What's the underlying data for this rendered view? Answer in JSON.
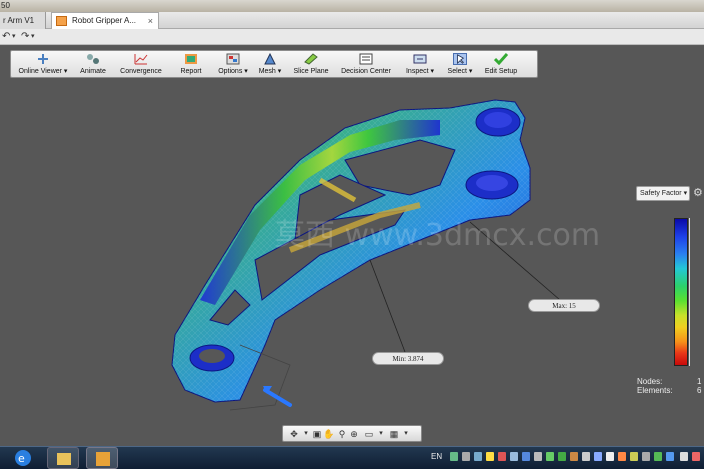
{
  "window": {
    "title_fragment": "50"
  },
  "tabs": [
    {
      "label": "r Arm V1"
    },
    {
      "label": "Robot Gripper A...",
      "close": "×"
    }
  ],
  "quick_access": {
    "undo": "↶",
    "redo": "↷"
  },
  "ribbon": [
    {
      "label": "Online Viewer ▾",
      "icon": "online-viewer-icon"
    },
    {
      "label": "Animate",
      "icon": "animate-icon"
    },
    {
      "label": "Convergence",
      "icon": "convergence-icon"
    },
    {
      "label": "Report",
      "icon": "report-icon"
    },
    {
      "label": "Options ▾",
      "icon": "options-icon"
    },
    {
      "label": "Mesh ▾",
      "icon": "mesh-icon"
    },
    {
      "label": "Slice Plane",
      "icon": "slice-plane-icon"
    },
    {
      "label": "Decision Center",
      "icon": "decision-center-icon"
    },
    {
      "label": "Inspect ▾",
      "icon": "inspect-icon"
    },
    {
      "label": "Select ▾",
      "icon": "select-icon"
    },
    {
      "label": "Edit Setup",
      "icon": "edit-setup-icon"
    }
  ],
  "legend": {
    "dropdown": "Safety Factor ▾",
    "settings_icon": "⚙"
  },
  "stats": {
    "nodes_label": "Nodes:",
    "nodes_value": "1",
    "elements_label": "Elements:",
    "elements_value": "6"
  },
  "callouts": {
    "min": "Min: 3.874",
    "max": "Max: 15"
  },
  "watermark": "莫西 www.3dmcx.com",
  "taskbar": {
    "language": "EN"
  },
  "colors": {
    "ribbon_bg": "#ececec",
    "canvas_bg": "#575757",
    "taskbar_bg": "#1a2b42",
    "mesh_blue": "#1e2fd0",
    "mesh_green": "#3fc83a"
  }
}
